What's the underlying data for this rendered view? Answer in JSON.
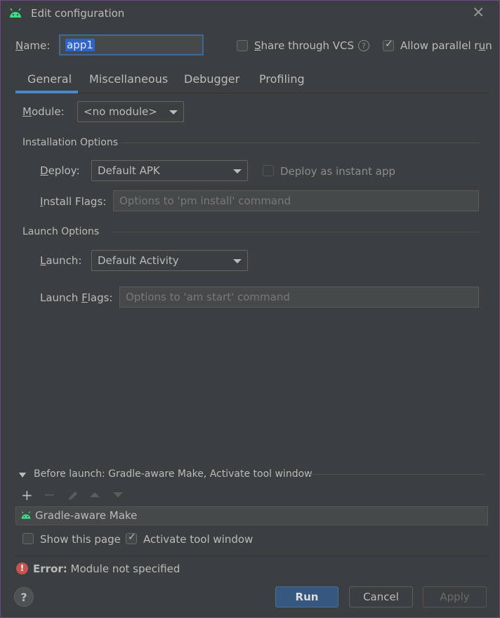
{
  "window": {
    "title": "Edit configuration",
    "close_icon": "close-icon",
    "app_icon": "android-icon"
  },
  "header": {
    "name_label": "Name:",
    "name_value": "app1",
    "share_vcs_label": "Share through VCS",
    "share_vcs_checked": false,
    "help_icon": "question-icon",
    "parallel_label": "Allow parallel run",
    "parallel_checked": true
  },
  "tabs": [
    {
      "label": "General",
      "active": true
    },
    {
      "label": "Miscellaneous",
      "active": false
    },
    {
      "label": "Debugger",
      "active": false
    },
    {
      "label": "Profiling",
      "active": false
    }
  ],
  "module": {
    "label": "Module:",
    "value": "<no module>"
  },
  "installation": {
    "section_title": "Installation Options",
    "deploy_label": "Deploy:",
    "deploy_value": "Default APK",
    "instant_label": "Deploy as instant app",
    "instant_checked": false,
    "flags_label": "Install Flags:",
    "flags_placeholder": "Options to 'pm install' command"
  },
  "launch": {
    "section_title": "Launch Options",
    "launch_label": "Launch:",
    "launch_value": "Default Activity",
    "flags_label": "Launch Flags:",
    "flags_placeholder": "Options to 'am start' command"
  },
  "before_launch": {
    "title": "Before launch: Gradle-aware Make, Activate tool window",
    "toolbar": [
      "add-icon",
      "remove-icon",
      "edit-icon",
      "move-up-icon",
      "move-down-icon"
    ],
    "tasks": [
      {
        "label": "Gradle-aware Make",
        "icon": "android-icon"
      }
    ],
    "show_page_label": "Show this page",
    "show_page_checked": false,
    "activate_label": "Activate tool window",
    "activate_checked": true
  },
  "status": {
    "error_prefix": "Error:",
    "error_message": "Module not specified",
    "error_color": "#c75450"
  },
  "footer": {
    "help": "?",
    "run": "Run",
    "cancel": "Cancel",
    "apply": "Apply"
  },
  "colors": {
    "background": "#3c3f41",
    "accent": "#4a88c7",
    "primary_button": "#365880",
    "selection": "#2f65ca"
  }
}
